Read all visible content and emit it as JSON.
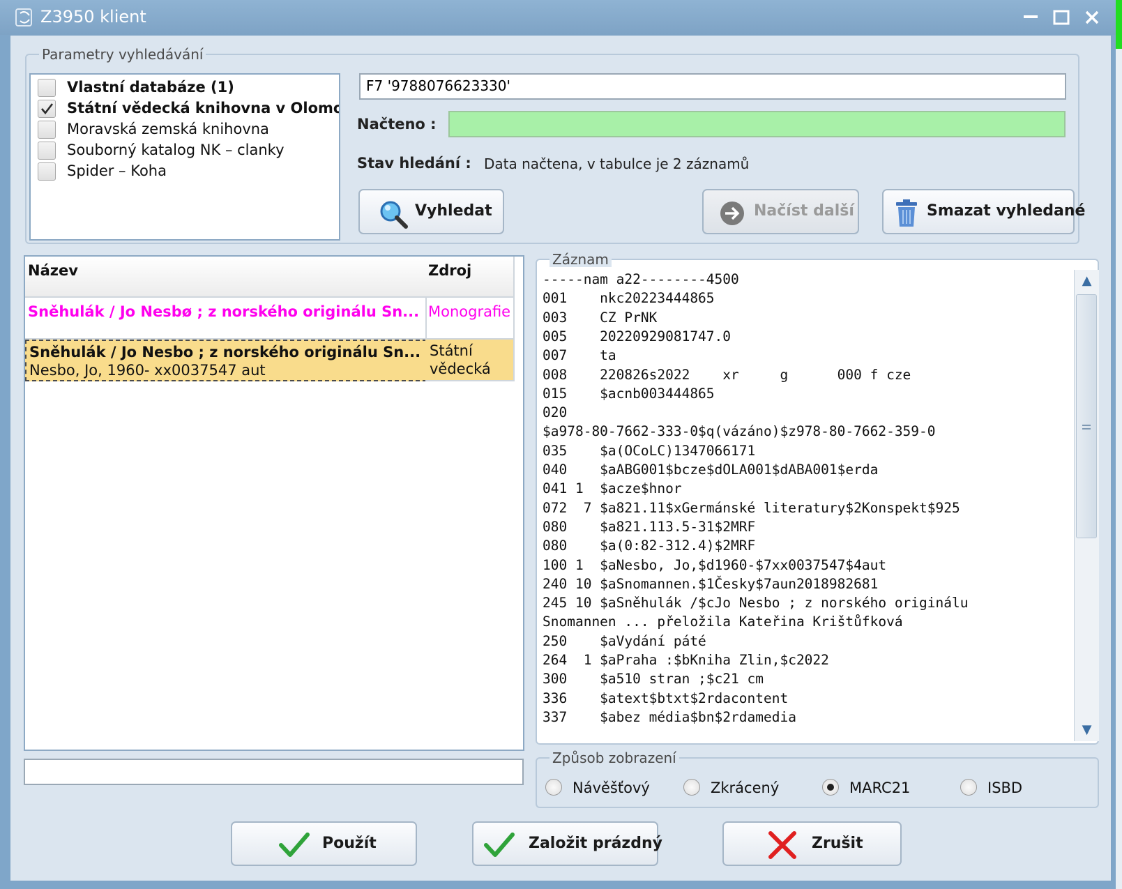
{
  "window": {
    "title": "Z3950 klient",
    "minimize_label": "—",
    "maximize_label": "☐",
    "close_label": "✕"
  },
  "search_params": {
    "legend": "Parametry vyhledávání",
    "databases": [
      {
        "label": "Vlastní databáze (1)",
        "checked": false,
        "bold": true
      },
      {
        "label": "Státní vědecká knihovna v Olomou",
        "checked": true,
        "bold": true
      },
      {
        "label": "Moravská zemská knihovna",
        "checked": false,
        "bold": false
      },
      {
        "label": "Souborný katalog NK – clanky",
        "checked": false,
        "bold": false
      },
      {
        "label": "Spider – Koha",
        "checked": false,
        "bold": false
      }
    ],
    "query_value": "F7 '9788076623330'",
    "loaded_label": "Načteno :",
    "loaded_progress": 1.0,
    "status_label": "Stav hledání :",
    "status_value": "Data načtena, v tabulce je 2 záznamů",
    "search_button": "Vyhledat",
    "load_more_button": "Načíst další",
    "delete_button": "Smazat vyhledané"
  },
  "results": {
    "columns": [
      "Název",
      "Zdroj"
    ],
    "rows": [
      {
        "title": "Sněhulák / Jo Nesbø ; z norského originálu Sn...",
        "source": "Monografie",
        "color": "#ff00ee"
      },
      {
        "title": "Sněhulák / Jo Nesbo ; z norského originálu Sn...",
        "subtitle": "Nesbo, Jo, 1960- xx0037547 aut",
        "source_line1": "Státní",
        "source_line2": "vědecká",
        "selected": true
      }
    ],
    "status_value": ""
  },
  "record": {
    "legend": "Záznam",
    "lines": [
      "-----nam a22--------4500",
      "001    nkc20223444865",
      "003    CZ PrNK",
      "005    20220929081747.0",
      "007    ta",
      "008    220826s2022    xr     g      000 f cze",
      "015    $acnb003444865",
      "020",
      "$a978-80-7662-333-0$q(vázáno)$z978-80-7662-359-0",
      "035    $a(OCoLC)1347066171",
      "040    $aABG001$bcze$dOLA001$dABA001$erda",
      "041 1  $acze$hnor",
      "072  7 $a821.11$xGermánské literatury$2Konspekt$925",
      "080    $a821.113.5-31$2MRF",
      "080    $a(0:82-312.4)$2MRF",
      "100 1  $aNesbo, Jo,$d1960-$7xx0037547$4aut",
      "240 10 $aSnomannen.$1Česky$7aun2018982681",
      "245 10 $aSněhulák /$cJo Nesbo ; z norského originálu",
      "Snomannen ... přeložila Kateřina Krištůfková",
      "250    $aVydání páté",
      "264  1 $aPraha :$bKniha Zlin,$c2022",
      "300    $a510 stran ;$c21 cm",
      "336    $atext$btxt$2rdacontent",
      "337    $abez média$bn$2rdamedia"
    ]
  },
  "display_mode": {
    "legend": "Způsob zobrazení",
    "options": [
      {
        "label": "Návěšťový",
        "selected": false
      },
      {
        "label": "Zkrácený",
        "selected": false
      },
      {
        "label": "MARC21",
        "selected": true
      },
      {
        "label": "ISBD",
        "selected": false
      }
    ]
  },
  "actions": {
    "use_button": "Použít",
    "create_empty_button": "Založit prázdný",
    "cancel_button": "Zrušit"
  },
  "colors": {
    "progress_fill": "#a8f0a8",
    "selected_row": "#f9dc8c",
    "highlight_text": "#ff00ee",
    "ok_check": "#2fa33a",
    "cancel_x": "#e02020"
  }
}
